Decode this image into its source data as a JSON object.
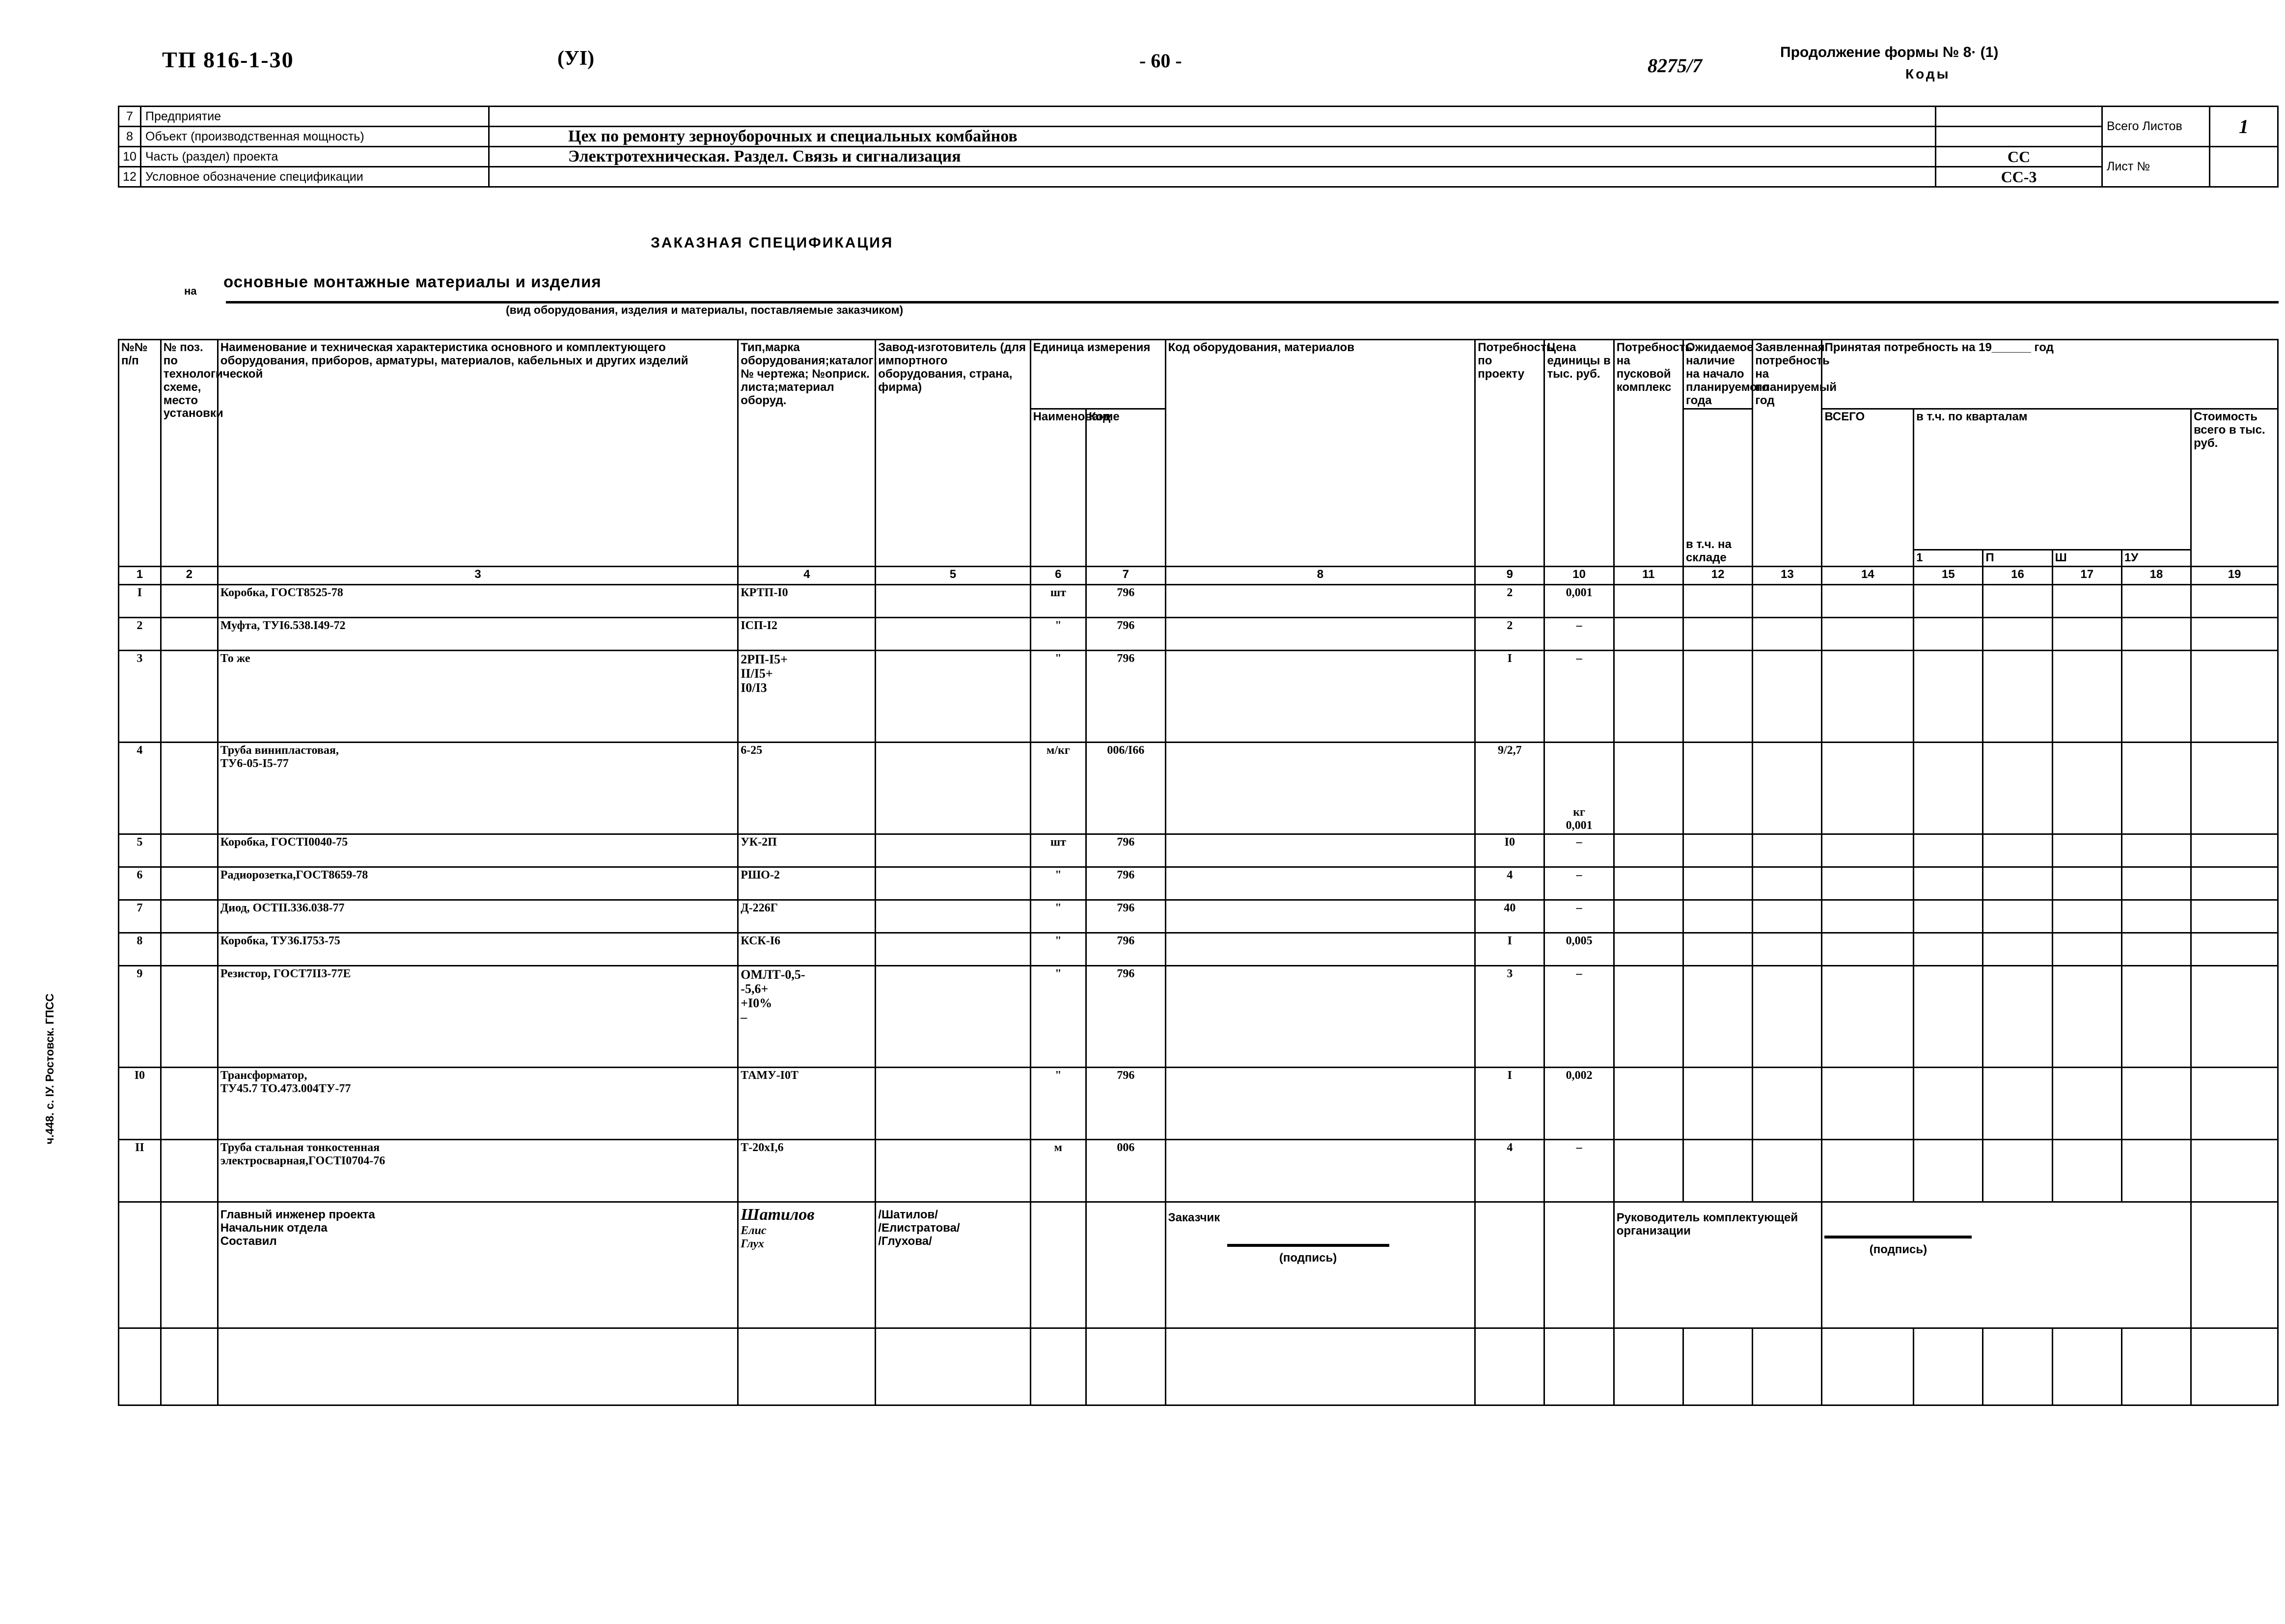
{
  "header": {
    "project_code": "ТП 816-1-30",
    "volume": "(УI)",
    "page_number": "- 60 -",
    "doc_number": "8275/7",
    "form_continuation": "Продолжение формы № 8· (1)",
    "codes_label": "Коды"
  },
  "info_table": {
    "rows": [
      {
        "num": "7",
        "label": "Предприятие",
        "value": "",
        "code": ""
      },
      {
        "num": "8",
        "label": "Объект (производственная мощность)",
        "value": "Цех по ремонту зерноуборочных и специальных комбайнов",
        "code": ""
      },
      {
        "num": "10",
        "label": "Часть (раздел) проекта",
        "value": "Электротехническая. Раздел. Связь и сигнализация",
        "code": "СС"
      },
      {
        "num": "12",
        "label": "Условное обозначение спецификации",
        "value": "",
        "code": "СС-3"
      }
    ],
    "total_sheets_label": "Всего Листов",
    "total_sheets_value": "1",
    "sheet_no_label": "Лист №",
    "sheet_no_value": ""
  },
  "title": {
    "main": "ЗАКАЗНАЯ  СПЕЦИФИКАЦИЯ",
    "prefix": "на",
    "subject": "основные монтажные материалы и изделия",
    "note": "(вид оборудования, изделия и материалы, поставляемые заказчиком)"
  },
  "columns": {
    "c1": "№№ п/п",
    "c2": "№ поз. по технологической схеме, место установки",
    "c3": "Наименование и техническая характеристика основного и комплектующего оборудования, приборов, арматуры, материалов, кабельных и других изделий",
    "c4": "Тип,марка оборудования;каталог; № чертежа; №оприск. листа;материал оборуд.",
    "c5": "Завод-изготовитель (для импортного оборудования, страна, фирма)",
    "c6_group": "Единица измерения",
    "c6": "Наименование",
    "c7": "Код",
    "c8": "Код оборудования, материалов",
    "c9": "Потребность по проекту",
    "c10": "Цена единицы в тыс. руб.",
    "c11": "Потребность на пусковой комплекс",
    "c12": "Ожидаемое наличие на начало планируемого года",
    "c12b": "в т.ч. на складе",
    "c13": "Заявленная потребность на планируемый год",
    "c14_group": "Принятая потребность на 19______ год",
    "c14": "ВСЕГО",
    "quarters_group": "в т.ч. по кварталам",
    "q1": "1",
    "q2": "П",
    "q3": "Ш",
    "q4": "1У",
    "c19": "Стоимость всего в тыс. руб.",
    "numbers": [
      "1",
      "2",
      "3",
      "4",
      "5",
      "6",
      "7",
      "8",
      "9",
      "10",
      "11",
      "12",
      "13",
      "14",
      "15",
      "16",
      "17",
      "18",
      "19"
    ]
  },
  "rows": [
    {
      "n": "I",
      "pos": "",
      "name": "Коробка, ГОСТ8525-78",
      "type": "КРТП-I0",
      "factory": "",
      "unit": "шт",
      "unit_code": "796",
      "eq_code": "",
      "need": "2",
      "price": "0,001",
      "price_note": ""
    },
    {
      "n": "2",
      "pos": "",
      "name": "Муфта, ТУI6.538.I49-72",
      "type": "IСП-I2",
      "factory": "",
      "unit": "\"",
      "unit_code": "796",
      "eq_code": "",
      "need": "2",
      "price": "–",
      "price_note": ""
    },
    {
      "n": "3",
      "pos": "",
      "name": "То же",
      "type": "2РП-I5+\nII/I5+\nI0/I3",
      "factory": "",
      "unit": "\"",
      "unit_code": "796",
      "eq_code": "",
      "need": "I",
      "price": "–",
      "price_note": ""
    },
    {
      "n": "4",
      "pos": "",
      "name": "Труба винипластовая,\nТУ6-05-I5-77",
      "type": "6-25",
      "factory": "",
      "unit": "м/кг",
      "unit_code": "006/I66",
      "eq_code": "",
      "need": "9/2,7",
      "price": "0,001",
      "price_note": "кг"
    },
    {
      "n": "5",
      "pos": "",
      "name": "Коробка, ГОСТI0040-75",
      "type": "УК-2П",
      "factory": "",
      "unit": "шт",
      "unit_code": "796",
      "eq_code": "",
      "need": "I0",
      "price": "–",
      "price_note": ""
    },
    {
      "n": "6",
      "pos": "",
      "name": "Радиорозетка,ГОСТ8659-78",
      "type": "РШО-2",
      "factory": "",
      "unit": "\"",
      "unit_code": "796",
      "eq_code": "",
      "need": "4",
      "price": "–",
      "price_note": ""
    },
    {
      "n": "7",
      "pos": "",
      "name": "Диод, ОСТII.336.038-77",
      "type": "Д-226Г",
      "factory": "",
      "unit": "\"",
      "unit_code": "796",
      "eq_code": "",
      "need": "40",
      "price": "–",
      "price_note": ""
    },
    {
      "n": "8",
      "pos": "",
      "name": "Коробка, ТУ36.I753-75",
      "type": "КСК-I6",
      "factory": "",
      "unit": "\"",
      "unit_code": "796",
      "eq_code": "",
      "need": "I",
      "price": "0,005",
      "price_note": ""
    },
    {
      "n": "9",
      "pos": "",
      "name": "Резистор, ГОСТ7II3-77Е",
      "type": "ОМЛТ-0,5-\n-5,6+\n+I0%\n–",
      "factory": "",
      "unit": "\"",
      "unit_code": "796",
      "eq_code": "",
      "need": "3",
      "price": "–",
      "price_note": ""
    },
    {
      "n": "I0",
      "pos": "",
      "name": "Трансформатор,\nТУ45.7 ТО.473.004ТУ-77",
      "type": "ТАМУ-I0Т",
      "factory": "",
      "unit": "\"",
      "unit_code": "796",
      "eq_code": "",
      "need": "I",
      "price": "0,002",
      "price_note": ""
    },
    {
      "n": "II",
      "pos": "",
      "name": "Труба стальная тонкостенная\nэлектросварная,ГОСТI0704-76",
      "type": "Т-20хI,6",
      "factory": "",
      "unit": "м",
      "unit_code": "006",
      "eq_code": "",
      "need": "4",
      "price": "–",
      "price_note": ""
    }
  ],
  "footer": {
    "role1": "Главный инженер проекта",
    "role2": "Начальник отдела",
    "role3": "Составил",
    "name1": "/Шатилов/",
    "name2": "/Елистратова/",
    "name3": "/Глухова/",
    "sig1": "Шатилов",
    "sig2": "Елис",
    "sig3": "Глух",
    "customer": "Заказчик",
    "customer_sig_caption": "(подпись)",
    "supplier": "Руководитель комплектующей\nорганизации",
    "supplier_sig_caption": "(подпись)"
  },
  "side_note": "ч.448. с. IУ. Ростовск. ГПСС"
}
